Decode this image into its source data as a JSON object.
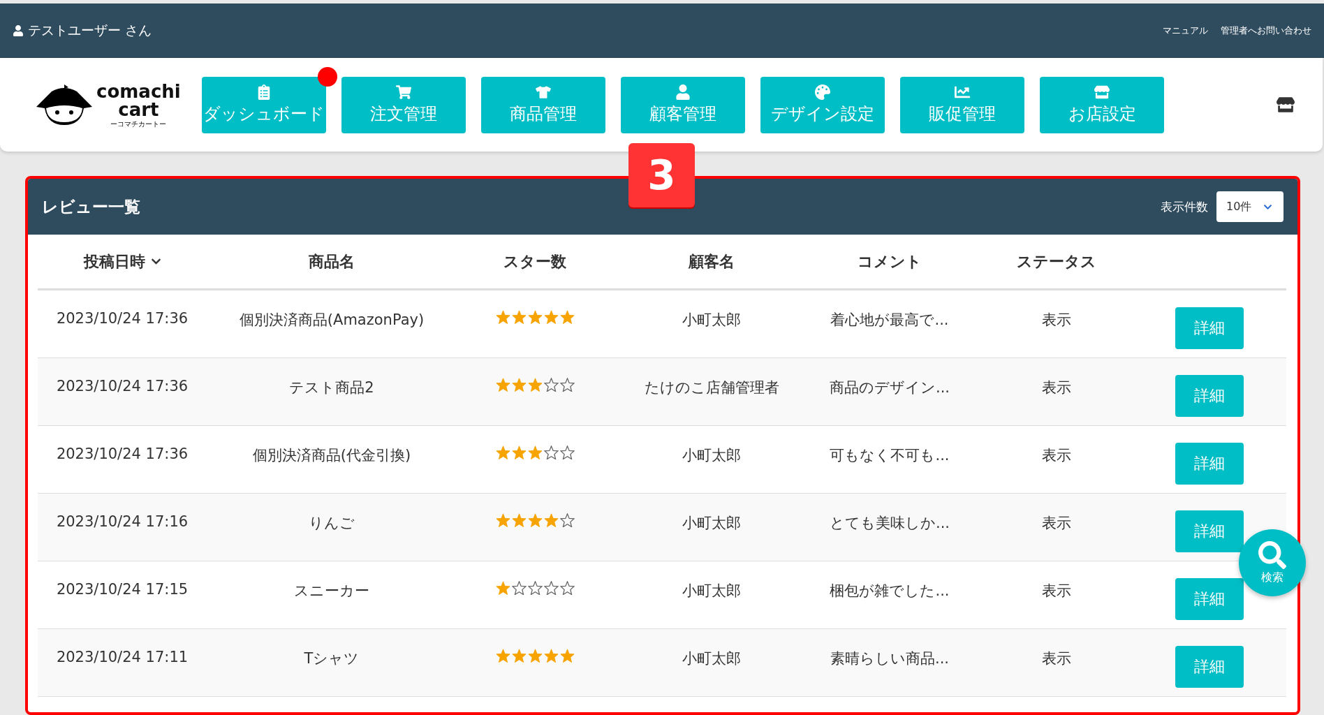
{
  "top_bar": {
    "user": "テストユーザー さん",
    "links": [
      "マニュアル",
      "管理者へお問い合わせ"
    ]
  },
  "logo": {
    "line_1": "comachi",
    "line_2": "cart",
    "tagline": "ーコマチカートー"
  },
  "nav": [
    {
      "label": "ダッシュボード",
      "notification": true
    },
    {
      "label": "注文管理",
      "notification": false
    },
    {
      "label": "商品管理",
      "notification": false
    },
    {
      "label": "顧客管理",
      "notification": false
    },
    {
      "label": "デザイン設定",
      "notification": false
    },
    {
      "label": "販促管理",
      "notification": false
    },
    {
      "label": "お店設定",
      "notification": false
    }
  ],
  "step_badge": "3",
  "panel": {
    "title": "レビュー一覧",
    "page_size_label": "表示件数",
    "page_size": "10件"
  },
  "table": {
    "columns": [
      {
        "label": "投稿日時",
        "sorted": true
      },
      {
        "label": "商品名",
        "sorted": false
      },
      {
        "label": "スター数",
        "sorted": false
      },
      {
        "label": "顧客名",
        "sorted": false
      },
      {
        "label": "コメント",
        "sorted": false
      },
      {
        "label": "ステータス",
        "sorted": false
      }
    ],
    "rows": [
      {
        "date": "2023/10/24 17:36",
        "product": "個別決済商品(AmazonPay)",
        "stars": 5,
        "customer": "小町太郎",
        "comment": "着心地が最高で...",
        "status": "表示",
        "action": "詳細"
      },
      {
        "date": "2023/10/24 17:36",
        "product": "テスト商品2",
        "stars": 3,
        "customer": "たけのこ店舗管理者",
        "comment": "商品のデザイン...",
        "status": "表示",
        "action": "詳細"
      },
      {
        "date": "2023/10/24 17:36",
        "product": "個別決済商品(代金引換)",
        "stars": 3,
        "customer": "小町太郎",
        "comment": "可もなく不可も...",
        "status": "表示",
        "action": "詳細"
      },
      {
        "date": "2023/10/24 17:16",
        "product": "りんご",
        "stars": 4,
        "customer": "小町太郎",
        "comment": "とても美味しか...",
        "status": "表示",
        "action": "詳細"
      },
      {
        "date": "2023/10/24 17:15",
        "product": "スニーカー",
        "stars": 1,
        "customer": "小町太郎",
        "comment": "梱包が雑でした...",
        "status": "表示",
        "action": "詳細"
      },
      {
        "date": "2023/10/24 17:11",
        "product": "Tシャツ",
        "stars": 5,
        "customer": "小町太郎",
        "comment": "素晴らしい商品...",
        "status": "表示",
        "action": "詳細"
      }
    ]
  },
  "search_button": {
    "label": "検索"
  }
}
